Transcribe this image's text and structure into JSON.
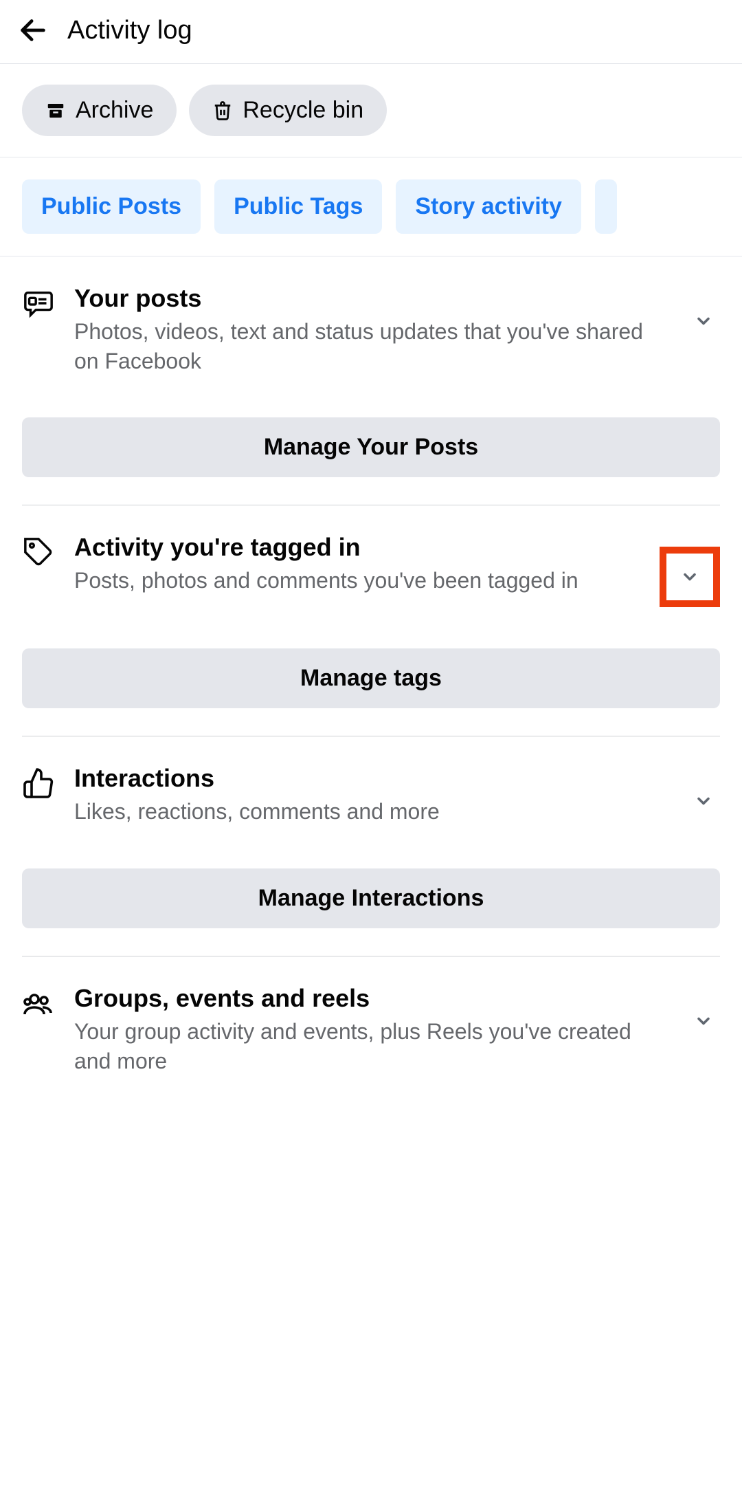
{
  "header": {
    "title": "Activity log"
  },
  "actions": {
    "archive": "Archive",
    "recycle_bin": "Recycle bin"
  },
  "tabs": {
    "public_posts": "Public Posts",
    "public_tags": "Public Tags",
    "story_activity": "Story activity"
  },
  "sections": {
    "your_posts": {
      "title": "Your posts",
      "subtitle": "Photos, videos, text and status updates that you've shared on Facebook",
      "manage": "Manage Your Posts"
    },
    "tagged": {
      "title": "Activity you're tagged in",
      "subtitle": "Posts, photos and comments you've been tagged in",
      "manage": "Manage tags"
    },
    "interactions": {
      "title": "Interactions",
      "subtitle": "Likes, reactions, comments and more",
      "manage": "Manage Interactions"
    },
    "groups": {
      "title": "Groups, events and reels",
      "subtitle": "Your group activity and events, plus Reels you've created and more"
    }
  }
}
